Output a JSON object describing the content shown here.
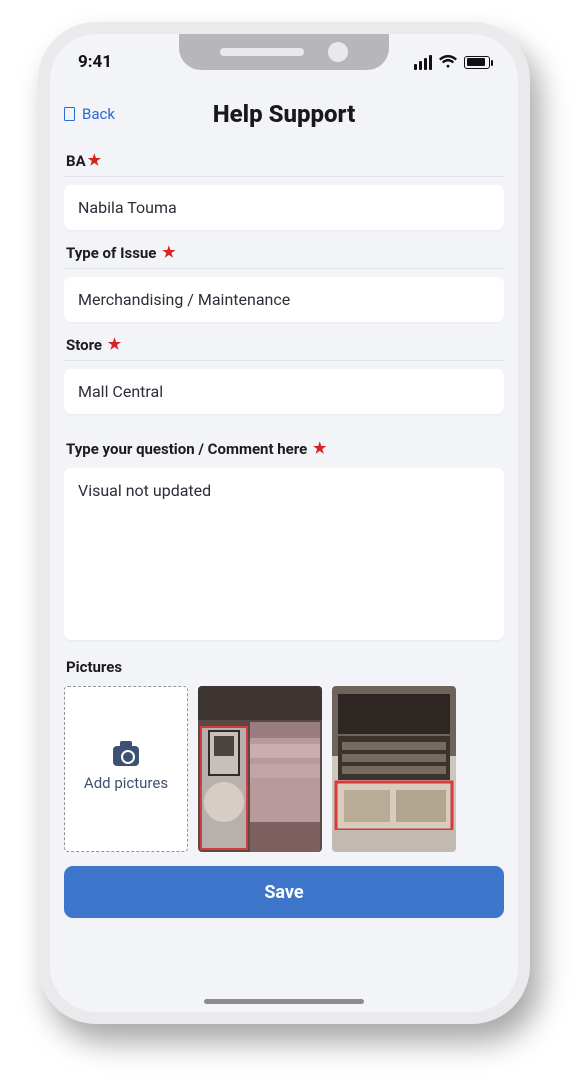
{
  "status": {
    "time": "9:41"
  },
  "header": {
    "back_label": "Back",
    "title": "Help Support"
  },
  "form": {
    "ba": {
      "label": "BA",
      "required": true,
      "value": "Nabila Touma"
    },
    "issue_type": {
      "label": "Type of Issue",
      "required": true,
      "value": "Merchandising / Maintenance"
    },
    "store": {
      "label": "Store",
      "required": true,
      "value": "Mall Central"
    },
    "comment": {
      "label": "Type your question / Comment here",
      "required": true,
      "value": "Visual not updated"
    },
    "pictures": {
      "label": "Pictures",
      "add_label": "Add pictures"
    }
  },
  "save_label": "Save",
  "required_marker": "★"
}
